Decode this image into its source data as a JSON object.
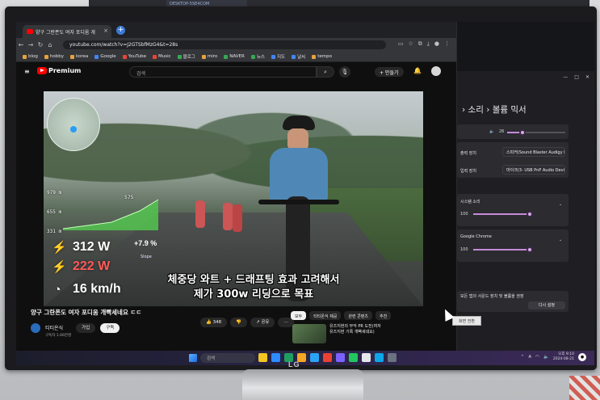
{
  "browser": {
    "tab_title": "양구 그란폰도 여자 포디움 개",
    "tab_close": "×",
    "new_tab": "+",
    "url": "youtube.com/watch?v=J2GTSbfMzG4&t=28s",
    "bookmarks": [
      "blog",
      "hobby",
      "korea",
      "Google",
      "YouTube",
      "Music",
      "블로그",
      "miro",
      "NAVER",
      "뉴스",
      "지도",
      "날씨",
      "tempo"
    ]
  },
  "youtube": {
    "logo": "Premium",
    "search_placeholder": "검색",
    "create_label": "+ 만들기",
    "video_title": "양구 그란폰도 여자 포디움 개빡세네요 ㄷㄷ",
    "channel_name": "티티온식",
    "subscribers": "구독자 1.66만명",
    "join_label": "가입",
    "subscribe_label": "구독",
    "like_count": "348",
    "share_label": "공유",
    "chips": [
      "모두",
      "티티온식 제공",
      "관련 콘텐츠",
      "추천"
    ],
    "suggestion": {
      "line1": "유즈지현의 부악 PR 도전(여자",
      "line2": "유즈지현 기록 개빡세네요)"
    }
  },
  "overlay": {
    "elevations": [
      "979 m",
      "655 m",
      "331 m"
    ],
    "elev_marker": "575",
    "power": "312 W",
    "power_avg": "222 W",
    "speed": "16 km/h",
    "slope": "+7.9 %",
    "slope_sub": "Slope",
    "subtitle_line1": "체중당 와트 + 드래프팅 효과 고려해서",
    "subtitle_line2": "제가 300w 리딩으로 목표"
  },
  "settings": {
    "crumb": "› 소리 › 볼륨 믹서",
    "master_volume": "26",
    "output_label": "출력 장치",
    "output_device": "스피커(Sound Blaster Audigy Fx)",
    "input_label": "입력 장치",
    "input_device": "마이크(3- USB PnP Audio Device)",
    "system_sounds_label": "시스템 소리",
    "system_sounds_value": "100",
    "chrome_label": "Google Chrome",
    "chrome_value": "100",
    "reset_hint": "모든 앱의 사운드 장치 및 볼륨을 권장",
    "reset_button": "다시 설정",
    "popup_note": "화면 전환"
  },
  "taskbar": {
    "search_placeholder": "검색",
    "time": "오후 9:10",
    "date": "2024-08-21"
  },
  "colors": {
    "youtube_red": "#ff0000",
    "power_red": "#ff5a5a",
    "accent_purple": "#c58ad8"
  },
  "volumes": {
    "master_fraction": 0.26,
    "system_fraction": 1.0,
    "chrome_fraction": 1.0
  }
}
